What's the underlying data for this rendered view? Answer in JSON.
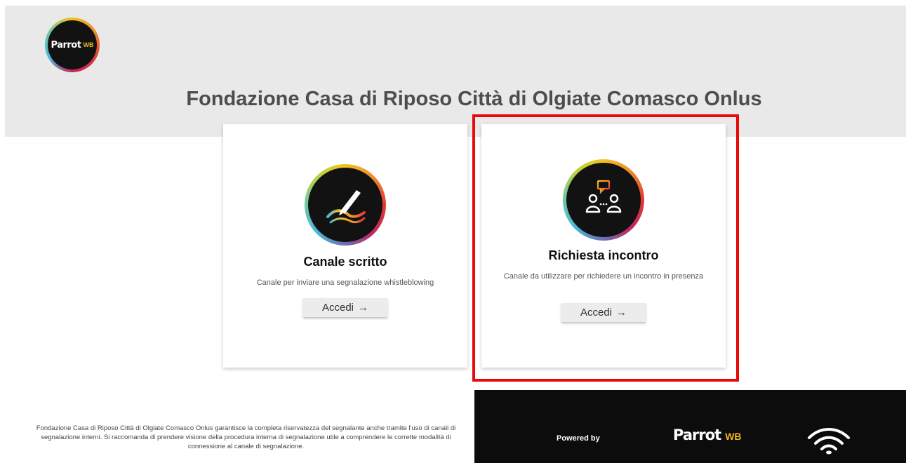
{
  "header": {
    "logo_text": "Parrot",
    "logo_mark": "WB",
    "title": "Fondazione Casa di Riposo Città di Olgiate Comasco Onlus"
  },
  "cards": [
    {
      "icon": "pen-icon",
      "title": "Canale scritto",
      "description": "Canale per inviare una segnalazione whistleblowing",
      "button_label": "Accedi",
      "button_arrow": "→"
    },
    {
      "icon": "meeting-icon",
      "title": "Richiesta incontro",
      "description": "Canale da utilizzare per richiedere un incontro in presenza",
      "button_label": "Accedi",
      "button_arrow": "→"
    }
  ],
  "footer": {
    "notice": "Fondazione Casa di Riposo Città di Olgiate Comasco Onlus garantisce la completa riservatezza del segnalante anche tramite l'uso di canali di segnalazione interni. Si raccomanda di prendere visione della procedura interna di segnalazione utile a comprendere le corrette modalità di connessione al canale di segnalazione.",
    "powered_by": "Powered by",
    "brand_text": "Parrot",
    "brand_mark": "WB"
  },
  "colors": {
    "header_bg": "#e9e9e9",
    "highlight": "#e8090b",
    "footer_dark": "#0c0c0c",
    "accent_yellow": "#f2b61d"
  }
}
